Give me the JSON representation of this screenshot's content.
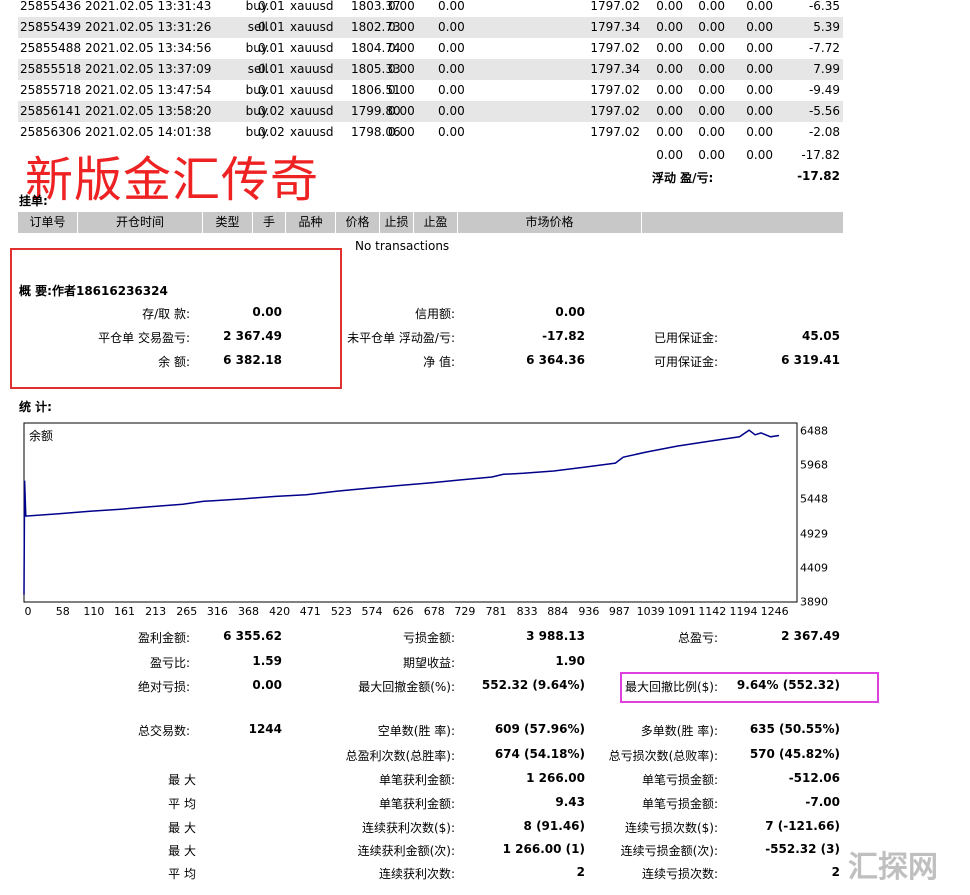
{
  "orders": [
    {
      "ticket": "25855436",
      "time": "2021.02.05 13:31:43",
      "type": "buy",
      "size": "0.01",
      "symbol": "xauusd",
      "price": "1803.37",
      "sl": "0.00",
      "tp": "0.00",
      "close": "1797.02",
      "commission": "0.00",
      "taxes": "0.00",
      "swap": "0.00",
      "profit": "-6.35"
    },
    {
      "ticket": "25855439",
      "time": "2021.02.05 13:31:26",
      "type": "sell",
      "size": "0.01",
      "symbol": "xauusd",
      "price": "1802.73",
      "sl": "0.00",
      "tp": "0.00",
      "close": "1797.34",
      "commission": "0.00",
      "taxes": "0.00",
      "swap": "0.00",
      "profit": "5.39"
    },
    {
      "ticket": "25855488",
      "time": "2021.02.05 13:34:56",
      "type": "buy",
      "size": "0.01",
      "symbol": "xauusd",
      "price": "1804.74",
      "sl": "0.00",
      "tp": "0.00",
      "close": "1797.02",
      "commission": "0.00",
      "taxes": "0.00",
      "swap": "0.00",
      "profit": "-7.72"
    },
    {
      "ticket": "25855518",
      "time": "2021.02.05 13:37:09",
      "type": "sell",
      "size": "0.01",
      "symbol": "xauusd",
      "price": "1805.33",
      "sl": "0.00",
      "tp": "0.00",
      "close": "1797.34",
      "commission": "0.00",
      "taxes": "0.00",
      "swap": "0.00",
      "profit": "7.99"
    },
    {
      "ticket": "25855718",
      "time": "2021.02.05 13:47:54",
      "type": "buy",
      "size": "0.01",
      "symbol": "xauusd",
      "price": "1806.51",
      "sl": "0.00",
      "tp": "0.00",
      "close": "1797.02",
      "commission": "0.00",
      "taxes": "0.00",
      "swap": "0.00",
      "profit": "-9.49"
    },
    {
      "ticket": "25856141",
      "time": "2021.02.05 13:58:20",
      "type": "buy",
      "size": "0.02",
      "symbol": "xauusd",
      "price": "1799.80",
      "sl": "0.00",
      "tp": "0.00",
      "close": "1797.02",
      "commission": "0.00",
      "taxes": "0.00",
      "swap": "0.00",
      "profit": "-5.56"
    },
    {
      "ticket": "25856306",
      "time": "2021.02.05 14:01:38",
      "type": "buy",
      "size": "0.02",
      "symbol": "xauusd",
      "price": "1798.06",
      "sl": "0.00",
      "tp": "0.00",
      "close": "1797.02",
      "commission": "0.00",
      "taxes": "0.00",
      "swap": "0.00",
      "profit": "-2.08"
    }
  ],
  "totals": {
    "commission": "0.00",
    "taxes": "0.00",
    "swap": "0.00",
    "profit": "-17.82"
  },
  "floating": {
    "label": "浮动 盈/亏:",
    "value": "-17.82"
  },
  "watermark_overlay": "新版金汇传奇",
  "pending": {
    "title": "挂单:",
    "headers": [
      "订单号",
      "开仓时间",
      "类型",
      "手",
      "品种",
      "价格",
      "止损",
      "止盈",
      "市场价格",
      ""
    ],
    "empty": "No transactions"
  },
  "summary": {
    "title": "概 要:作者18616236324",
    "deposit_label": "存/取 款:",
    "deposit": "0.00",
    "credit_label": "信用额:",
    "credit": "0.00",
    "closed_pl_label": "平仓单 交易盈亏:",
    "closed_pl": "2 367.49",
    "floating_pl_label": "未平仓单 浮动盈/亏:",
    "floating_pl": "-17.82",
    "margin_label": "已用保证金:",
    "margin": "45.05",
    "balance_label": "余 额:",
    "balance": "6 382.18",
    "equity_label": "净 值:",
    "equity": "6 364.36",
    "free_margin_label": "可用保证金:",
    "free_margin": "6 319.41"
  },
  "stats_title": "统 计:",
  "chart_data": {
    "type": "line",
    "title": "余额",
    "series": [
      {
        "name": "余额",
        "x": [
          0,
          1,
          3,
          58,
          110,
          161,
          213,
          265,
          300,
          316,
          368,
          420,
          471,
          500,
          523,
          574,
          626,
          678,
          729,
          781,
          800,
          833,
          884,
          936,
          987,
          1000,
          1039,
          1091,
          1142,
          1194,
          1210,
          1220,
          1230,
          1246,
          1260
        ],
        "values": [
          4000,
          5735,
          5195,
          5232,
          5270,
          5300,
          5340,
          5375,
          5420,
          5430,
          5460,
          5495,
          5520,
          5550,
          5575,
          5620,
          5660,
          5700,
          5745,
          5790,
          5830,
          5845,
          5880,
          5940,
          6000,
          6090,
          6170,
          6260,
          6330,
          6400,
          6500,
          6430,
          6460,
          6400,
          6420
        ]
      }
    ],
    "x_ticks": [
      "0",
      "58",
      "110",
      "161",
      "213",
      "265",
      "316",
      "368",
      "420",
      "471",
      "523",
      "574",
      "626",
      "678",
      "729",
      "781",
      "833",
      "884",
      "936",
      "987",
      "1039",
      "1091",
      "1142",
      "1194",
      "1246"
    ],
    "y_ticks": [
      "6488",
      "5968",
      "5448",
      "4929",
      "4409",
      "3890"
    ],
    "xlim": [
      0,
      1290
    ],
    "ylim": [
      3890,
      6610
    ]
  },
  "stats": {
    "gross_profit_label": "盈利金额:",
    "gross_profit": "6 355.62",
    "gross_loss_label": "亏损金额:",
    "gross_loss": "3 988.13",
    "net_profit_label": "总盈亏:",
    "net_profit": "2 367.49",
    "profit_factor_label": "盈亏比:",
    "profit_factor": "1.59",
    "expected_payoff_label": "期望收益:",
    "expected_payoff": "1.90",
    "abs_dd_label": "绝对亏损:",
    "abs_dd": "0.00",
    "max_dd_label": "最大回撤金额(%):",
    "max_dd": "552.32 (9.64%)",
    "rel_dd_label": "最大回撤比例($):",
    "rel_dd": "9.64% (552.32)",
    "total_trades_label": "总交易数:",
    "total_trades": "1244",
    "short_label": "空单数(胜 率):",
    "short": "609 (57.96%)",
    "long_label": "多单数(胜 率):",
    "long": "635 (50.55%)",
    "profit_trades_label": "总盈利次数(总胜率):",
    "profit_trades": "674 (54.18%)",
    "loss_trades_label": "总亏损次数(总败率):",
    "loss_trades": "570 (45.82%)",
    "max1": "最 大",
    "largest_profit_label": "单笔获利金额:",
    "largest_profit": "1 266.00",
    "largest_loss_label": "单笔亏损金额:",
    "largest_loss": "-512.06",
    "avg1": "平 均",
    "avg_profit_label": "单笔获利金额:",
    "avg_profit": "9.43",
    "avg_loss_label": "单笔亏损金额:",
    "avg_loss": "-7.00",
    "max2": "最 大",
    "max_cons_wins_label": "连续获利次数($):",
    "max_cons_wins": "8 (91.46)",
    "max_cons_losses_label": "连续亏损次数($):",
    "max_cons_losses": "7 (-121.66)",
    "max3": "最 大",
    "max_cons_profit_label": "连续获利金额(次):",
    "max_cons_profit": "1 266.00 (1)",
    "max_cons_loss_label": "连续亏损金额(次):",
    "max_cons_loss": "-552.32 (3)",
    "avg2": "平 均",
    "avg_cons_wins_label": "连续获利次数:",
    "avg_cons_wins": "2",
    "avg_cons_losses_label": "连续亏损次数:",
    "avg_cons_losses": "2"
  },
  "corner_watermark": "汇探网",
  "colors": {
    "row_shade": "#e6e6e6",
    "header": "#c8c8c8",
    "chart_line": "#00008b",
    "red_box": "#e03030",
    "magenta_box": "#e040e0",
    "watermark_red": "#ee2222"
  }
}
